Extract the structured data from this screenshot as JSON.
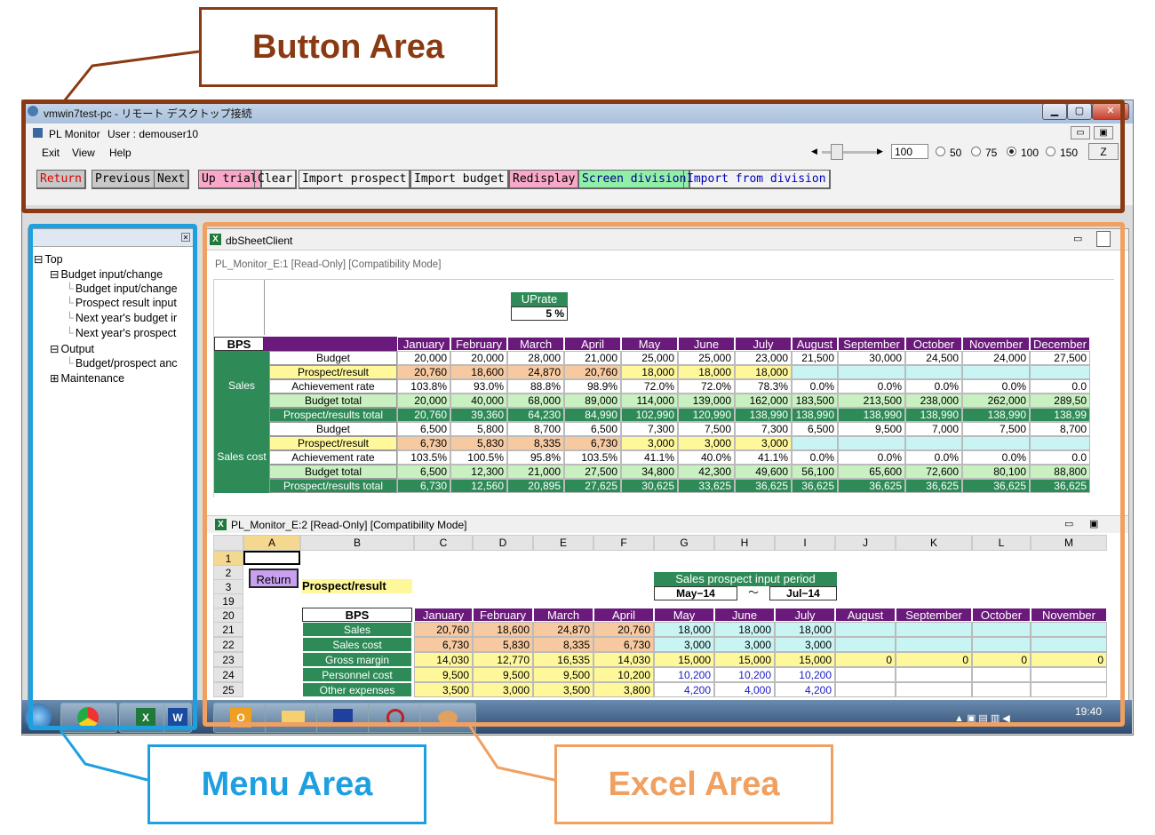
{
  "callouts": {
    "button_area": "Button Area",
    "menu_area": "Menu Area",
    "excel_area": "Excel Area"
  },
  "colors": {
    "button_frame": "#8a3a12",
    "menu_frame": "#1ea0e0",
    "excel_frame": "#f0a060",
    "header_purple": "#6a1a7a",
    "header_green": "#2e8b57",
    "budget_total_green": "#c8f0c0",
    "prospect_yellow": "#fff89a",
    "prospect_orange": "#f7c9a0",
    "light_cyan": "#c8f4f4"
  },
  "window": {
    "title": "vmwin7test-pc - リモート デスクトップ接続",
    "app_title": "PL Monitor",
    "user": "User : demouser10"
  },
  "menu": [
    "Exit",
    "View",
    "Help"
  ],
  "zoom": {
    "value": "100",
    "options": [
      "50",
      "75",
      "100",
      "150"
    ],
    "selected": "100",
    "z_button": "Z"
  },
  "buttons": [
    {
      "label": "Return",
      "bg": "#c8c8c8",
      "color": "#e00000"
    },
    {
      "label": "Previous",
      "bg": "#c8c8c8",
      "color": "#000000"
    },
    {
      "label": "Next",
      "bg": "#c8c8c8",
      "color": "#000000"
    },
    {
      "label": "Up trial",
      "bg": "#f8a8c8",
      "color": "#000000"
    },
    {
      "label": "Clear",
      "bg": "#f2f2f2",
      "color": "#000000"
    },
    {
      "label": "Import prospect",
      "bg": "#f2f2f2",
      "color": "#000000"
    },
    {
      "label": "Import budget",
      "bg": "#f2f2f2",
      "color": "#000000"
    },
    {
      "label": "Redisplay",
      "bg": "#f8a8c8",
      "color": "#000000"
    },
    {
      "label": "Screen division",
      "bg": "#90f0a8",
      "color": "#000080"
    },
    {
      "label": "Import from division",
      "bg": "#f2f2f2",
      "color": "#0000c0"
    }
  ],
  "tree": [
    {
      "label": "Top",
      "level": 0,
      "marker": "⊟"
    },
    {
      "label": "Budget input/change",
      "level": 1,
      "marker": "⊟"
    },
    {
      "label": "Budget input/change",
      "level": 2,
      "marker": ""
    },
    {
      "label": "Prospect result input",
      "level": 2,
      "marker": ""
    },
    {
      "label": "Next year's budget ir",
      "level": 2,
      "marker": ""
    },
    {
      "label": "Next year's prospect",
      "level": 2,
      "marker": ""
    },
    {
      "label": "Output",
      "level": 1,
      "marker": "⊟"
    },
    {
      "label": "Budget/prospect anc",
      "level": 2,
      "marker": ""
    },
    {
      "label": "Maintenance",
      "level": 1,
      "marker": "⊞"
    }
  ],
  "excel": {
    "client_title": "dbSheetClient",
    "sheet1_title": "PL_Monitor_E:1  [Read-Only]  [Compatibility Mode]",
    "sheet2_title": "PL_Monitor_E:2  [Read-Only]  [Compatibility Mode]",
    "uprate_label": "UPrate",
    "uprate_value": "5 %",
    "bps": "BPS",
    "months": [
      "January",
      "February",
      "March",
      "April",
      "May",
      "June",
      "July",
      "August",
      "September",
      "October",
      "November",
      "December"
    ],
    "sales_label": "Sales",
    "salescost_label": "Sales cost",
    "rows1": [
      {
        "label": "Budget",
        "values": [
          "20,000",
          "20,000",
          "28,000",
          "21,000",
          "25,000",
          "25,000",
          "23,000",
          "21,500",
          "30,000",
          "24,500",
          "24,000",
          "27,500"
        ]
      },
      {
        "label": "Prospect/result",
        "values": [
          "20,760",
          "18,600",
          "24,870",
          "20,760",
          "18,000",
          "18,000",
          "18,000",
          "",
          "",
          "",
          "",
          ""
        ]
      },
      {
        "label": "Achievement rate",
        "values": [
          "103.8%",
          "93.0%",
          "88.8%",
          "98.9%",
          "72.0%",
          "72.0%",
          "78.3%",
          "0.0%",
          "0.0%",
          "0.0%",
          "0.0%",
          "0.0"
        ]
      },
      {
        "label": "Budget total",
        "values": [
          "20,000",
          "40,000",
          "68,000",
          "89,000",
          "114,000",
          "139,000",
          "162,000",
          "183,500",
          "213,500",
          "238,000",
          "262,000",
          "289,50"
        ]
      },
      {
        "label": "Prospect/results total",
        "values": [
          "20,760",
          "39,360",
          "64,230",
          "84,990",
          "102,990",
          "120,990",
          "138,990",
          "138,990",
          "138,990",
          "138,990",
          "138,990",
          "138,99"
        ]
      },
      {
        "label": "Budget",
        "values": [
          "6,500",
          "5,800",
          "8,700",
          "6,500",
          "7,300",
          "7,500",
          "7,300",
          "6,500",
          "9,500",
          "7,000",
          "7,500",
          "8,700"
        ]
      },
      {
        "label": "Prospect/result",
        "values": [
          "6,730",
          "5,830",
          "8,335",
          "6,730",
          "3,000",
          "3,000",
          "3,000",
          "",
          "",
          "",
          "",
          ""
        ]
      },
      {
        "label": "Achievement rate",
        "values": [
          "103.5%",
          "100.5%",
          "95.8%",
          "103.5%",
          "41.1%",
          "40.0%",
          "41.1%",
          "0.0%",
          "0.0%",
          "0.0%",
          "0.0%",
          "0.0"
        ]
      },
      {
        "label": "Budget total",
        "values": [
          "6,500",
          "12,300",
          "21,000",
          "27,500",
          "34,800",
          "42,300",
          "49,600",
          "56,100",
          "65,600",
          "72,600",
          "80,100",
          "88,800"
        ]
      },
      {
        "label": "Prospect/results total",
        "values": [
          "6,730",
          "12,560",
          "20,895",
          "27,625",
          "30,625",
          "33,625",
          "36,625",
          "36,625",
          "36,625",
          "36,625",
          "36,625",
          "36,625"
        ]
      }
    ],
    "col_letters": [
      "A",
      "B",
      "C",
      "D",
      "E",
      "F",
      "G",
      "H",
      "I",
      "J",
      "K",
      "L",
      "M"
    ],
    "row_numbers": [
      "1",
      "2",
      "3",
      "19",
      "20",
      "21",
      "22",
      "23",
      "24",
      "25"
    ],
    "return_btn": "Return",
    "prospect_result": "Prospect/result",
    "period_title": "Sales prospect input period",
    "period_from": "May−14",
    "period_sep": "〜",
    "period_to": "Jul−14",
    "bps2": "BPS",
    "months2": [
      "January",
      "February",
      "March",
      "April",
      "May",
      "June",
      "July",
      "August",
      "September",
      "October",
      "November"
    ],
    "rows2": [
      {
        "label": "Sales",
        "values": [
          "20,760",
          "18,600",
          "24,870",
          "20,760",
          "18,000",
          "18,000",
          "18,000",
          "",
          "",
          "",
          ""
        ]
      },
      {
        "label": "Sales cost",
        "values": [
          "6,730",
          "5,830",
          "8,335",
          "6,730",
          "3,000",
          "3,000",
          "3,000",
          "",
          "",
          "",
          ""
        ]
      },
      {
        "label": "Gross margin",
        "values": [
          "14,030",
          "12,770",
          "16,535",
          "14,030",
          "15,000",
          "15,000",
          "15,000",
          "0",
          "0",
          "0",
          "0"
        ]
      },
      {
        "label": "Personnel cost",
        "values": [
          "9,500",
          "9,500",
          "9,500",
          "10,200",
          "10,200",
          "10,200",
          "10,200",
          "",
          "",
          "",
          ""
        ]
      },
      {
        "label": "Other expenses",
        "values": [
          "3,500",
          "3,000",
          "3,500",
          "3,800",
          "4,200",
          "4,000",
          "4,200",
          "",
          "",
          "",
          ""
        ]
      }
    ]
  },
  "clock": "19:40"
}
